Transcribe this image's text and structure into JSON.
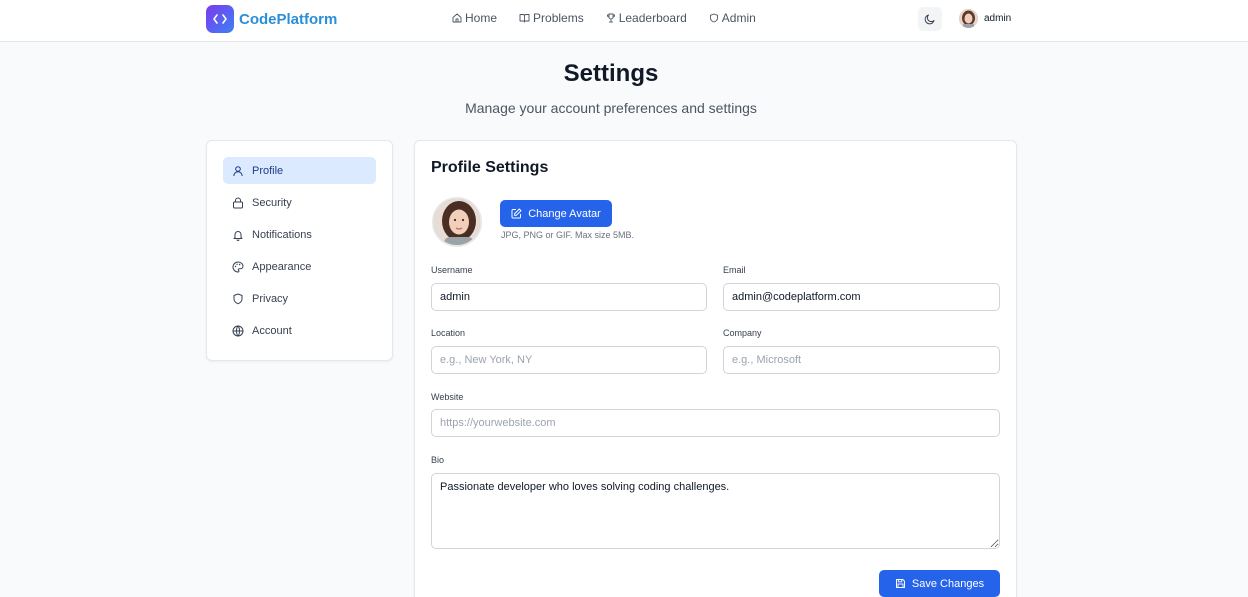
{
  "brand": {
    "name": "CodePlatform",
    "logo_icon": "code-brackets-icon"
  },
  "nav": {
    "links": [
      {
        "label": "Home",
        "icon": "home-icon"
      },
      {
        "label": "Problems",
        "icon": "book-icon"
      },
      {
        "label": "Leaderboard",
        "icon": "trophy-icon"
      },
      {
        "label": "Admin",
        "icon": "shield-icon"
      }
    ],
    "theme_icon": "moon-icon",
    "user": {
      "name": "admin"
    }
  },
  "header": {
    "title": "Settings",
    "subtitle": "Manage your account preferences and settings"
  },
  "sidebar": {
    "items": [
      {
        "label": "Profile",
        "icon": "user-icon",
        "active": true
      },
      {
        "label": "Security",
        "icon": "lock-icon",
        "active": false
      },
      {
        "label": "Notifications",
        "icon": "bell-icon",
        "active": false
      },
      {
        "label": "Appearance",
        "icon": "palette-icon",
        "active": false
      },
      {
        "label": "Privacy",
        "icon": "shield-icon",
        "active": false
      },
      {
        "label": "Account",
        "icon": "globe-icon",
        "active": false
      }
    ]
  },
  "profile": {
    "title": "Profile Settings",
    "change_avatar_label": "Change Avatar",
    "avatar_hint": "JPG, PNG or GIF. Max size 5MB.",
    "fields": {
      "username": {
        "label": "Username",
        "value": "admin",
        "placeholder": ""
      },
      "email": {
        "label": "Email",
        "value": "admin@codeplatform.com",
        "placeholder": ""
      },
      "location": {
        "label": "Location",
        "value": "",
        "placeholder": "e.g., New York, NY"
      },
      "company": {
        "label": "Company",
        "value": "",
        "placeholder": "e.g., Microsoft"
      },
      "website": {
        "label": "Website",
        "value": "",
        "placeholder": "https://yourwebsite.com"
      },
      "bio": {
        "label": "Bio",
        "value": "Passionate developer who loves solving coding challenges."
      }
    },
    "save_label": "Save Changes"
  },
  "colors": {
    "accent": "#2563eb",
    "active_bg": "#dbeafe",
    "brand_gradient_start": "#7c3aed",
    "brand_gradient_end": "#3b82f6"
  }
}
